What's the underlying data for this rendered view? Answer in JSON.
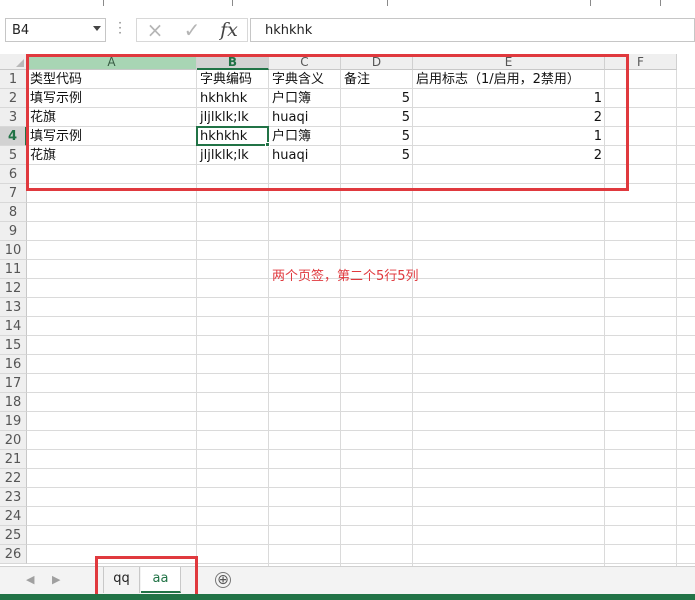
{
  "formula_bar": {
    "name_box": "B4",
    "cancel_icon": "×",
    "enter_icon": "✓",
    "fx_label": "fx",
    "formula": "hkhkhk"
  },
  "columns": [
    "A",
    "B",
    "C",
    "D",
    "E",
    "F"
  ],
  "selected_column": "B",
  "selected_row": "4",
  "rows": [
    "1",
    "2",
    "3",
    "4",
    "5",
    "6",
    "7",
    "8",
    "9",
    "10",
    "11",
    "12",
    "13",
    "14",
    "15",
    "16",
    "17",
    "18",
    "19",
    "20",
    "21",
    "22",
    "23",
    "24",
    "25",
    "26"
  ],
  "table": {
    "headers": [
      "类型代码",
      "字典编码",
      "字典含义",
      "备注",
      "启用标志（1/启用，2禁用）"
    ],
    "rows": [
      [
        "填写示例",
        "hkhkhk",
        "户口簿",
        "5",
        "1"
      ],
      [
        "花旗",
        "jljlklk;lk",
        "huaqi",
        "5",
        "2"
      ],
      [
        "填写示例",
        "hkhkhk",
        "户口簿",
        "5",
        "1"
      ],
      [
        "花旗",
        "jljlklk;lk",
        "huaqi",
        "5",
        "2"
      ]
    ]
  },
  "annotation": "两个页签，第二个5行5列",
  "sheet_tabs": [
    "qq",
    "aa"
  ],
  "active_sheet": "aa",
  "add_sheet_icon": "⊕",
  "accent_color": "#217346",
  "annotation_color": "#e0393e"
}
